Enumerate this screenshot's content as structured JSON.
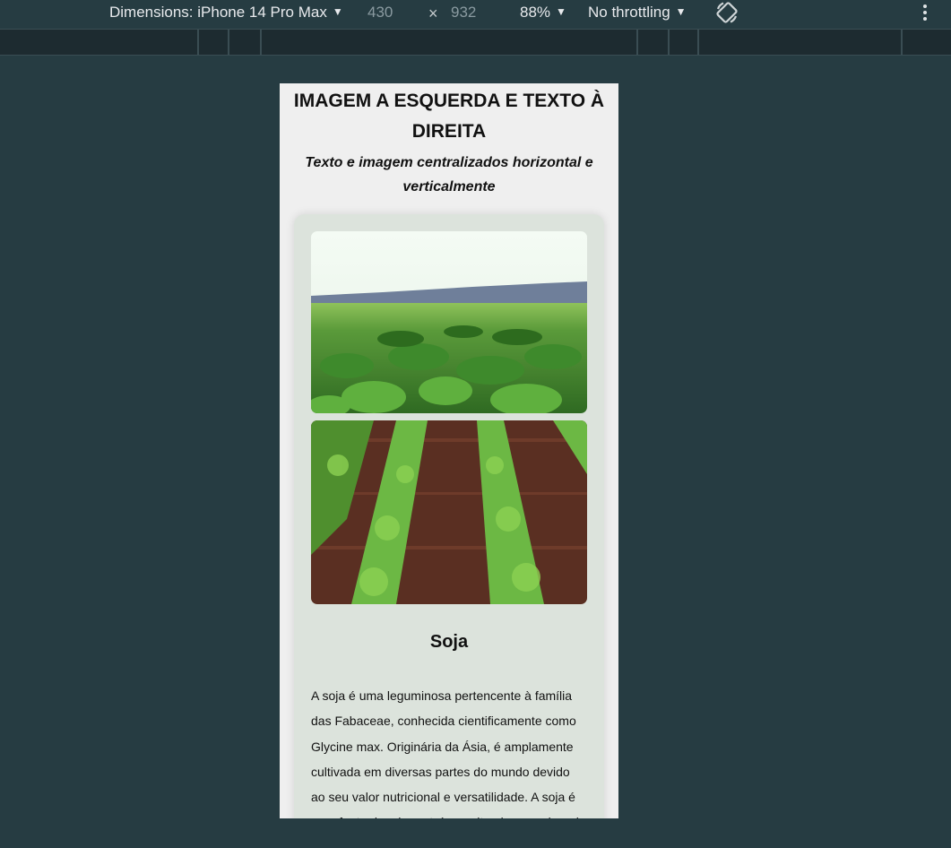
{
  "devtools": {
    "device_label": "Dimensions: iPhone 14 Pro Max",
    "width_value": "430",
    "times_sign": "×",
    "height_value": "932",
    "zoom": "88%",
    "throttling": "No throttling",
    "rotate_icon": "rotate-icon",
    "more_icon": "more-vertical-icon"
  },
  "page": {
    "title": "IMAGEM A ESQUERDA E TEXTO À DIREITA",
    "subtitle": "Texto e imagem centralizados horizontal e verticalmente",
    "card": {
      "title": "Soja",
      "text": "A soja é uma leguminosa pertencente à família das Fabaceae, conhecida cientificamente como Glycine max. Originária da Ásia, é amplamente cultivada em diversas partes do mundo devido ao seu valor nutricional e versatilidade. A soja é uma fonte rica de proteínas, vitaminas e minerais"
    }
  },
  "colors": {
    "devtools_bg": "#263c42",
    "viewport_bg": "#efefef",
    "card_bg": "#dce3dc"
  }
}
